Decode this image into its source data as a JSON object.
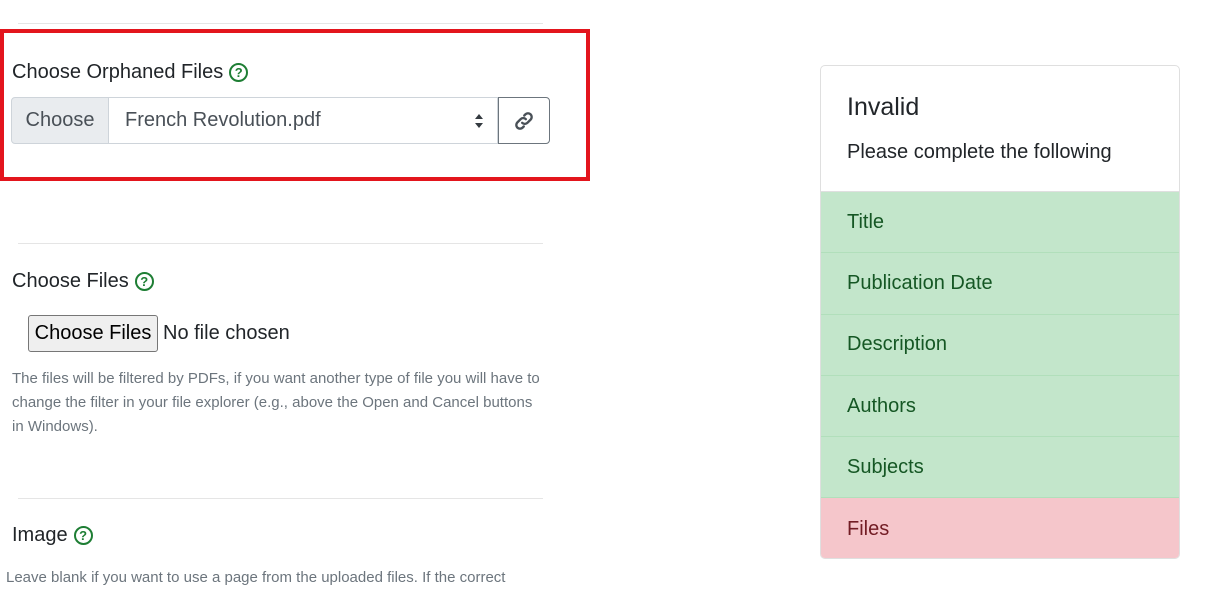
{
  "orphaned": {
    "label": "Choose Orphaned Files",
    "addon": "Choose",
    "selected": "French Revolution.pdf"
  },
  "files": {
    "label": "Choose Files",
    "button": "Choose Files",
    "status": "No file chosen",
    "hint": "The files will be filtered by PDFs, if you want another type of file you will have to change the filter in your file explorer (e.g., above the Open and Cancel buttons in Windows)."
  },
  "image": {
    "label": "Image",
    "hint": "Leave blank if you want to use a page from the uploaded files. If the correct"
  },
  "help_glyph": "?",
  "validation": {
    "title": "Invalid",
    "subtitle": "Please complete the following",
    "items": [
      {
        "label": "Title",
        "status": "valid"
      },
      {
        "label": "Publication Date",
        "status": "valid"
      },
      {
        "label": "Description",
        "status": "valid"
      },
      {
        "label": "Authors",
        "status": "valid"
      },
      {
        "label": "Subjects",
        "status": "valid"
      },
      {
        "label": "Files",
        "status": "invalid"
      }
    ]
  },
  "colors": {
    "highlight": "#e3151d",
    "help": "#1e7e34",
    "valid_bg": "#c3e6cb",
    "invalid_bg": "#f5c6cb"
  }
}
